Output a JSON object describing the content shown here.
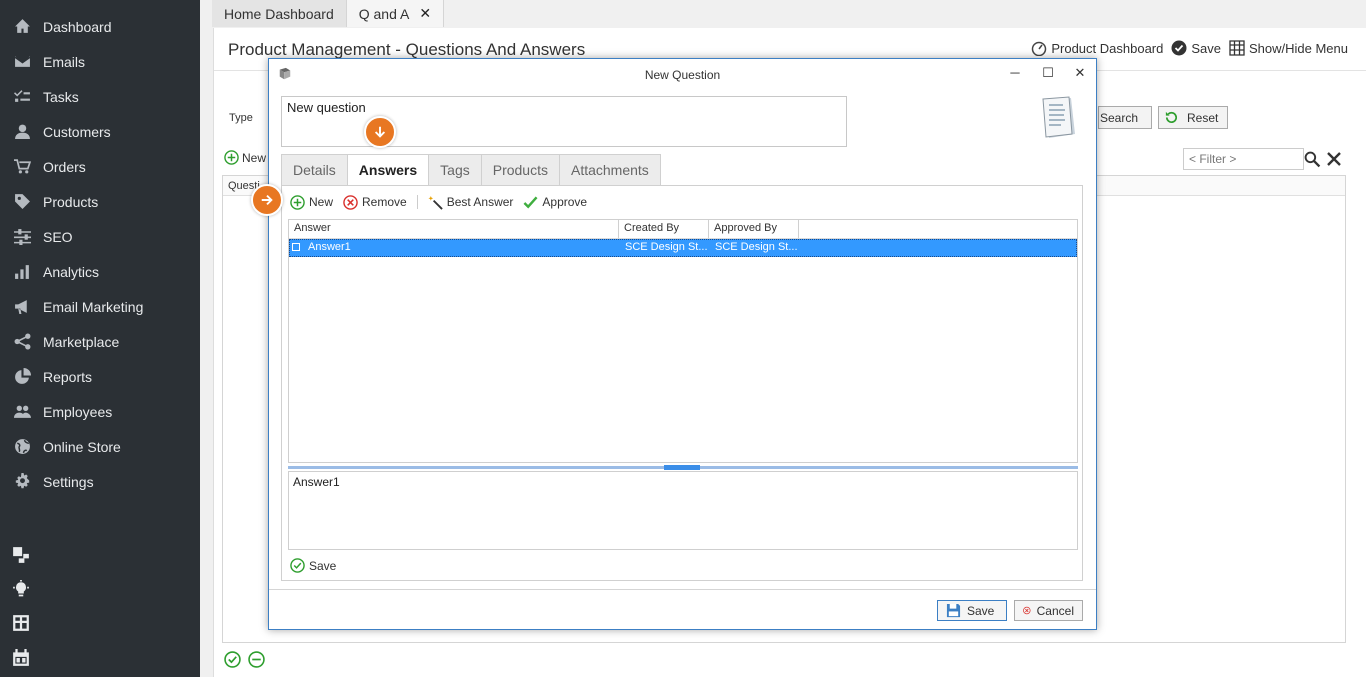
{
  "sidebar": {
    "items": [
      {
        "label": "Dashboard",
        "icon": "home-icon"
      },
      {
        "label": "Emails",
        "icon": "envelope-icon"
      },
      {
        "label": "Tasks",
        "icon": "tasks-icon"
      },
      {
        "label": "Customers",
        "icon": "user-icon"
      },
      {
        "label": "Orders",
        "icon": "cart-icon"
      },
      {
        "label": "Products",
        "icon": "tag-icon"
      },
      {
        "label": "SEO",
        "icon": "sliders-icon"
      },
      {
        "label": "Analytics",
        "icon": "bar-chart-icon"
      },
      {
        "label": "Email Marketing",
        "icon": "megaphone-icon"
      },
      {
        "label": "Marketplace",
        "icon": "share-icon"
      },
      {
        "label": "Reports",
        "icon": "pie-chart-icon"
      },
      {
        "label": "Employees",
        "icon": "users-icon"
      },
      {
        "label": "Online Store",
        "icon": "globe-icon"
      },
      {
        "label": "Settings",
        "icon": "gear-icon"
      }
    ]
  },
  "tabs": [
    {
      "label": "Home Dashboard"
    },
    {
      "label": "Q and A",
      "close": "✕"
    }
  ],
  "page": {
    "title": "Product Management - Questions And Answers",
    "actions": {
      "product_dashboard": "Product Dashboard",
      "save": "Save",
      "show_hide_menu": "Show/Hide Menu"
    },
    "type_label": "Type",
    "new_label": "New",
    "search_label": "Search",
    "reset_label": "Reset",
    "filter_placeholder": "< Filter >",
    "grid_header": "Questi"
  },
  "dialog": {
    "title": "New Question",
    "question": "New question",
    "tabs": [
      "Details",
      "Answers",
      "Tags",
      "Products",
      "Attachments"
    ],
    "active_tab": "Answers",
    "toolbar": {
      "new": "New",
      "remove": "Remove",
      "best_answer": "Best Answer",
      "approve": "Approve"
    },
    "columns": [
      "Answer",
      "Created By",
      "Approved By"
    ],
    "rows": [
      {
        "answer": "Answer1",
        "created_by": "SCE Design St...",
        "approved_by": "SCE Design St..."
      }
    ],
    "answer_text": "Answer1",
    "panel_save": "Save",
    "footer": {
      "save": "Save",
      "cancel": "Cancel"
    }
  },
  "colors": {
    "sidebar_bg": "#2b3035",
    "selection": "#3399ff",
    "hint": "#e87722",
    "success": "#2e9e2e",
    "danger": "#d9302c"
  }
}
